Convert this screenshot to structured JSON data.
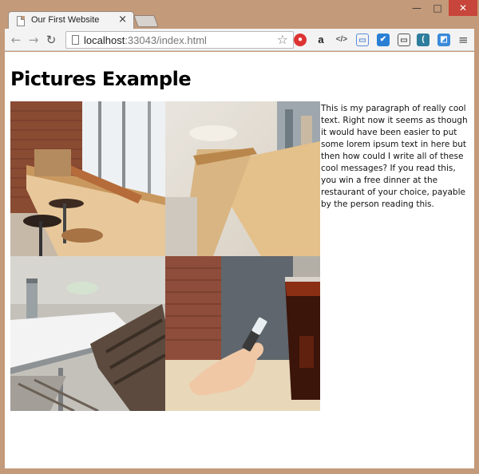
{
  "window": {
    "tab_title": "Our First Website",
    "tab_close": "×",
    "min_label": "—",
    "max_label": "□",
    "close_label": "✕"
  },
  "toolbar": {
    "back_icon": "←",
    "forward_icon": "→",
    "reload_icon": "↻",
    "url_host": "localhost",
    "url_rest": ":33043/index.html",
    "star_icon": "☆",
    "menu_icon": "≡",
    "extensions": [
      "●",
      "a",
      "</>",
      "▭",
      "✔",
      "▭",
      "(",
      "◩"
    ]
  },
  "page": {
    "heading": "Pictures Example",
    "paragraph": "This is my paragraph of really cool text. Right now it seems as though it would have been easier to put some lorem ipsum text in here but then how could I write all of these cool messages? If you read this, you win a free dinner at the restaurant of your choice, payable by the person reading this."
  }
}
